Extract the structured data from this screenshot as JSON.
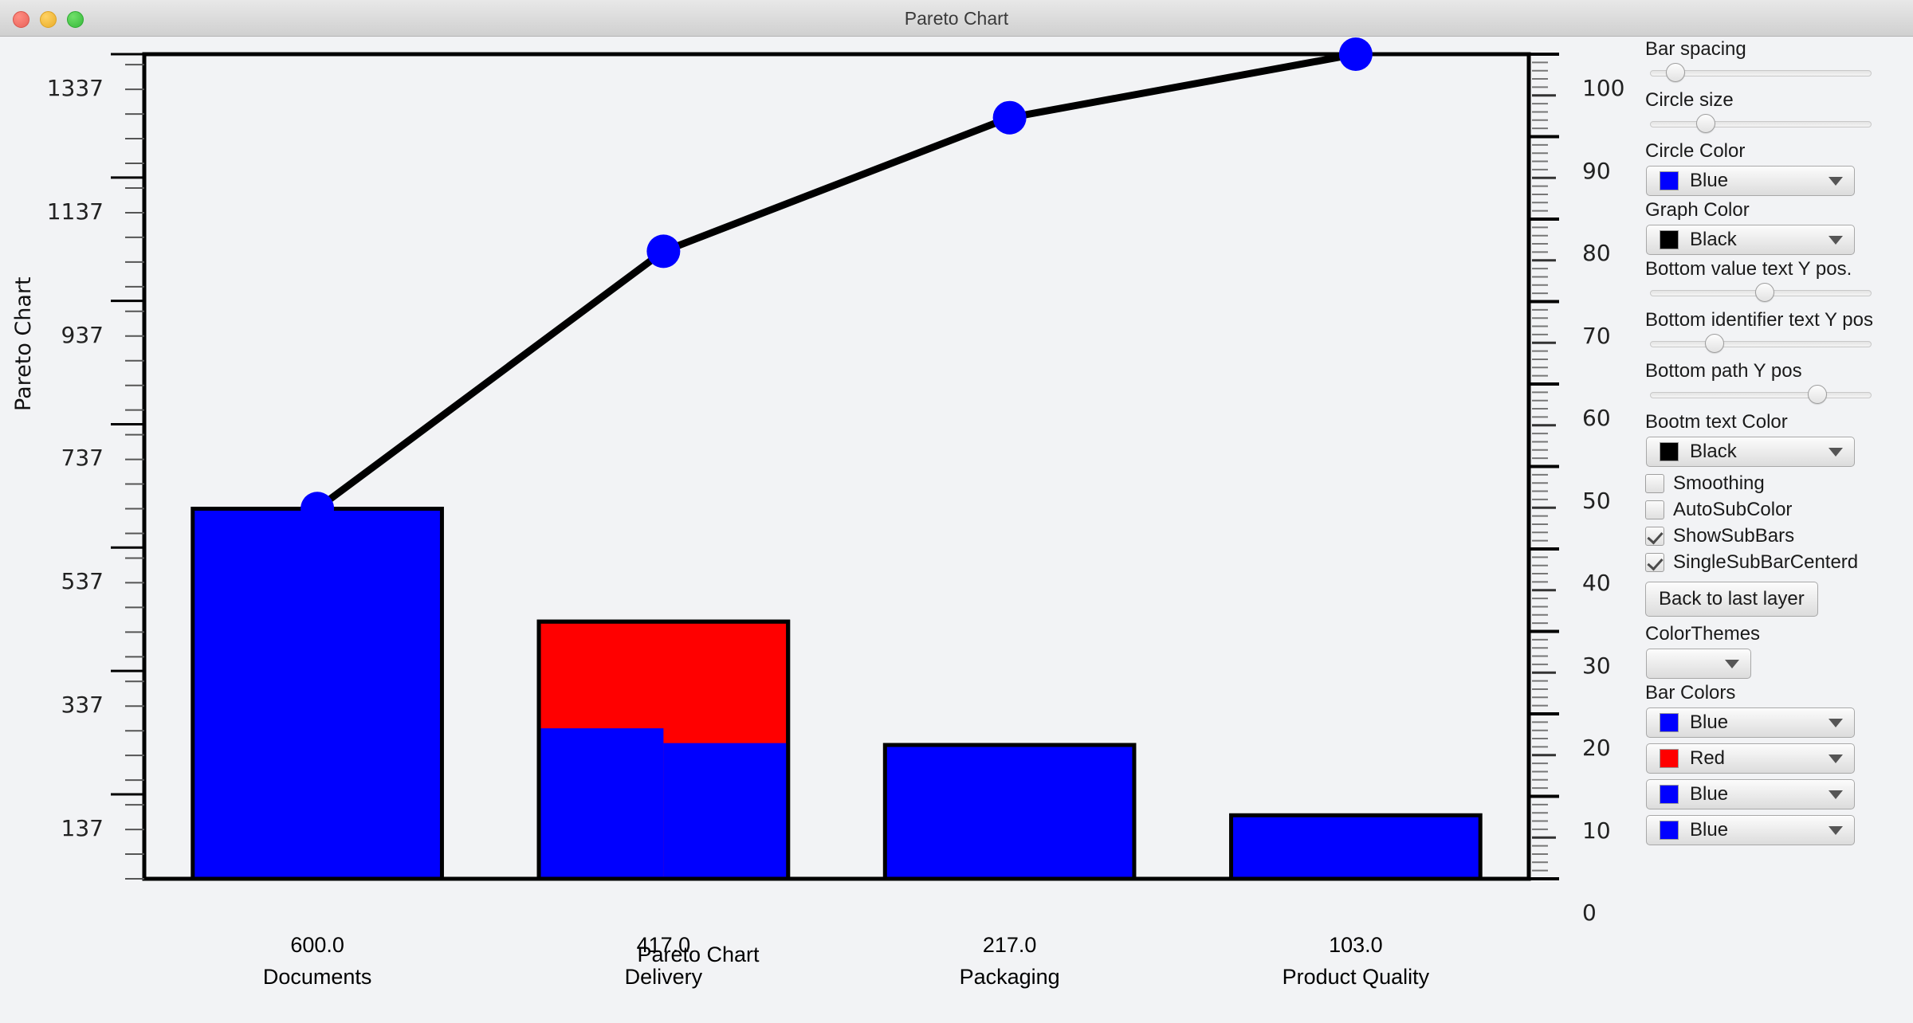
{
  "window": {
    "title": "Pareto Chart",
    "controls": {
      "close": "close",
      "minimize": "minimize",
      "maximize": "maximize"
    }
  },
  "chart_data": {
    "type": "bar",
    "title": "Pareto Chart",
    "bottom_title": "Pareto Chart",
    "ylabel": "Pareto Chart",
    "xlabel": "",
    "categories": [
      "Documents",
      "Delivery",
      "Packaging",
      "Product Quality"
    ],
    "values": [
      600.0,
      417.0,
      217.0,
      103.0
    ],
    "value_labels": [
      "600.0",
      "417.0",
      "217.0",
      "103.0"
    ],
    "cumulative_values": [
      600,
      1017,
      1234,
      1337
    ],
    "cumulative_percent": [
      44.9,
      76.1,
      92.3,
      100.0
    ],
    "total": 1337,
    "bar_colors": [
      "#0000ff",
      "#ff0000",
      "#0000ff",
      "#0000ff"
    ],
    "sub_bars": {
      "series_of_bar": "Delivery",
      "bar_index": 1,
      "values": [
        244,
        220
      ],
      "color": "#0000ff"
    },
    "left_axis": {
      "ticks": [
        "1337",
        "1137",
        "937",
        "737",
        "537",
        "337",
        "137"
      ],
      "tick_values": [
        1337,
        1137,
        937,
        737,
        537,
        337,
        137
      ],
      "min": 0,
      "max": 1337,
      "minor_ticks_per_major": 4
    },
    "right_axis": {
      "ticks": [
        "100",
        "90",
        "80",
        "70",
        "60",
        "50",
        "40",
        "30",
        "20",
        "10",
        "0"
      ],
      "tick_values": [
        100,
        90,
        80,
        70,
        60,
        50,
        40,
        30,
        20,
        10,
        0
      ],
      "min": 0,
      "max": 100,
      "unit": "%"
    },
    "line": {
      "color": "#000000",
      "marker_color": "#0000ff",
      "marker_shape": "circle"
    },
    "grid": false,
    "legend": "none"
  },
  "panel": {
    "bar_spacing": {
      "label": "Bar spacing",
      "value": 8
    },
    "circle_size": {
      "label": "Circle size",
      "value": 23
    },
    "circle_color": {
      "label": "Circle Color",
      "value": "Blue",
      "swatch": "#0000ff"
    },
    "graph_color": {
      "label": "Graph Color",
      "value": "Black",
      "swatch": "#000000"
    },
    "bottom_value_text_y": {
      "label": "Bottom value text Y pos.",
      "value": 52
    },
    "bottom_identifier_text_y": {
      "label": "Bottom identifier text Y pos",
      "value": 27
    },
    "bottom_path_y": {
      "label": "Bottom path Y pos",
      "value": 78
    },
    "bottom_text_color": {
      "label": "Bootm text Color",
      "value": "Black",
      "swatch": "#000000"
    },
    "checkboxes": [
      {
        "label": "Smoothing",
        "checked": false
      },
      {
        "label": "AutoSubColor",
        "checked": false
      },
      {
        "label": "ShowSubBars",
        "checked": true
      },
      {
        "label": "SingleSubBarCenterd",
        "checked": true
      }
    ],
    "back_button": "Back to last layer",
    "color_themes": {
      "label": "ColorThemes",
      "value": ""
    },
    "bar_colors": {
      "label": "Bar Colors",
      "items": [
        {
          "value": "Blue",
          "swatch": "#0000ff"
        },
        {
          "value": "Red",
          "swatch": "#ff0000"
        },
        {
          "value": "Blue",
          "swatch": "#0000ff"
        },
        {
          "value": "Blue",
          "swatch": "#0000ff"
        }
      ]
    }
  }
}
